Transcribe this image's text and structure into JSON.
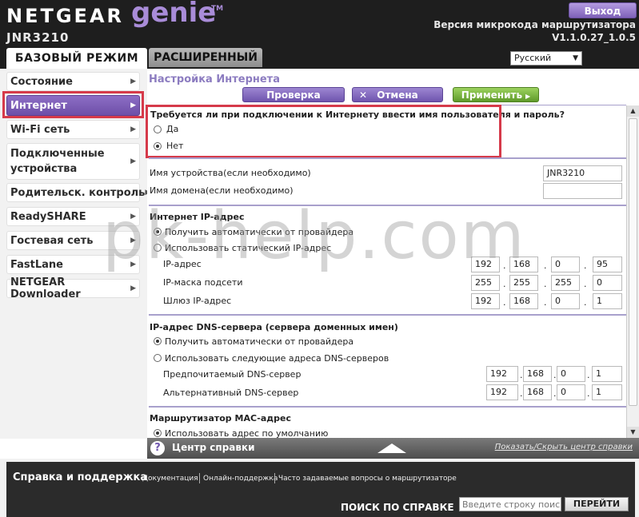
{
  "header": {
    "brand": "NETGEAR",
    "product": "genie",
    "tm": "TM",
    "model": "JNR3210",
    "logout_label": "Выход",
    "firmware_label": "Версия микрокода маршрутизатора",
    "firmware_version": "V1.1.0.27_1.0.5",
    "tabs": [
      {
        "label": "БАЗОВЫЙ РЕЖИМ",
        "active": true
      },
      {
        "label": "РАСШИРЕННЫЙ",
        "active": false
      }
    ],
    "language": "Русский"
  },
  "sidebar": {
    "items": [
      {
        "label": "Состояние"
      },
      {
        "label": "Интернет",
        "active": true
      },
      {
        "label": "Wi-Fi сеть"
      },
      {
        "label": "Подключенные устройства"
      },
      {
        "label": "Родительск. контроль"
      },
      {
        "label": "ReadySHARE"
      },
      {
        "label": "Гостевая сеть"
      },
      {
        "label": "FastLane"
      },
      {
        "label": "NETGEAR Downloader"
      }
    ]
  },
  "main": {
    "title": "Настройка Интернета",
    "buttons": {
      "check": "Проверка",
      "cancel": "Отмена",
      "apply": "Применить"
    },
    "login_question": "Требуется ли при подключении к Интернету ввести имя пользователя и пароль?",
    "login_options": [
      {
        "label": "Да",
        "selected": false
      },
      {
        "label": "Нет",
        "selected": true
      }
    ],
    "device_name_label": "Имя устройства(если необходимо)",
    "device_name_value": "JNR3210",
    "domain_name_label": "Имя домена(если необходимо)",
    "domain_name_value": "",
    "ip_section": {
      "title": "Интернет IP-адрес",
      "option_auto": "Получить автоматически от провайдера",
      "option_static": "Использовать статический IP-адрес",
      "auto_selected": true,
      "ip_label": "IP-адрес",
      "ip": [
        "192",
        "168",
        "0",
        "95"
      ],
      "mask_label": "IP-маска подсети",
      "mask": [
        "255",
        "255",
        "255",
        "0"
      ],
      "gateway_label": "Шлюз IP-адрес",
      "gateway": [
        "192",
        "168",
        "0",
        "1"
      ]
    },
    "dns_section": {
      "title": "IP-адрес DNS-сервера (сервера доменных имен)",
      "option_auto": "Получить автоматически от провайдера",
      "option_manual": "Использовать следующие адреса DNS-серверов",
      "auto_selected": true,
      "primary_label": "Предпочитаемый DNS-сервер",
      "primary": [
        "192",
        "168",
        "0",
        "1"
      ],
      "secondary_label": "Альтернативный DNS-сервер",
      "secondary": [
        "192",
        "168",
        "0",
        "1"
      ]
    },
    "mac_section": {
      "title": "Маршрутизатор MAC-адрес",
      "option_default": "Использовать адрес по умолчанию"
    }
  },
  "helpbar": {
    "title": "Центр справки",
    "toggle": "Показать/Скрыть центр справки"
  },
  "footer": {
    "title": "Справка и поддержка",
    "links": [
      "Документация",
      "Онлайн-поддержка",
      "Часто задаваемые вопросы о маршрутизаторе"
    ],
    "search_label": "ПОИСК ПО СПРАВКЕ",
    "search_placeholder": "Введите строку поиска",
    "search_button": "ПЕРЕЙТИ"
  },
  "watermark": "pk-help.com"
}
